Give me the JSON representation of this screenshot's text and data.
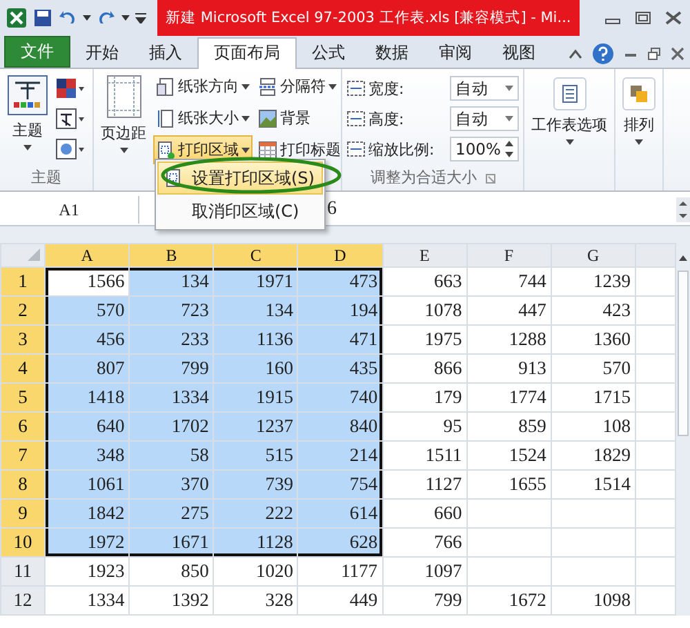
{
  "title_bar": {
    "title": "新建 Microsoft Excel 97-2003 工作表.xls  [兼容模式] - Mi..."
  },
  "tabs": [
    {
      "label": "文件",
      "kind": "file",
      "selected": false
    },
    {
      "label": "开始",
      "kind": "tab",
      "selected": false
    },
    {
      "label": "插入",
      "kind": "tab",
      "selected": false
    },
    {
      "label": "页面布局",
      "kind": "tab",
      "selected": true
    },
    {
      "label": "公式",
      "kind": "tab",
      "selected": false
    },
    {
      "label": "数据",
      "kind": "tab",
      "selected": false
    },
    {
      "label": "审阅",
      "kind": "tab",
      "selected": false
    },
    {
      "label": "视图",
      "kind": "tab",
      "selected": false
    }
  ],
  "theme_group": {
    "button": "主题",
    "label": "主题"
  },
  "page_setup_group": {
    "margins": "页边距",
    "items": [
      {
        "label": "纸张方向",
        "kind": "orientation",
        "dropdown": true,
        "active": false
      },
      {
        "label": "分隔符",
        "kind": "breaks",
        "dropdown": true,
        "active": false
      },
      {
        "label": "纸张大小",
        "kind": "size",
        "dropdown": true,
        "active": false
      },
      {
        "label": "背景",
        "kind": "background",
        "dropdown": false,
        "active": false
      },
      {
        "label": "打印区域",
        "kind": "print-area",
        "dropdown": true,
        "active": true
      },
      {
        "label": "打印标题",
        "kind": "print-titles",
        "dropdown": false,
        "active": false
      }
    ]
  },
  "scale_group": {
    "label": "调整为合适大小",
    "fields": [
      {
        "label": "宽度:",
        "value": "自动",
        "kind": "dropdown"
      },
      {
        "label": "高度:",
        "value": "自动",
        "kind": "dropdown"
      },
      {
        "label": "缩放比例:",
        "value": "100%",
        "kind": "spinner"
      }
    ]
  },
  "big_buttons": [
    {
      "label": "工作表选项",
      "kind": "sheet-options"
    },
    {
      "label": "排列",
      "kind": "arrange"
    }
  ],
  "menu": {
    "items": [
      {
        "label": "设置打印区域(S)",
        "selected": true,
        "circled": true
      },
      {
        "label": "取消印区域(C)",
        "selected": false,
        "circled": false
      }
    ]
  },
  "formula_bar": {
    "name_box": "A1",
    "value": "6"
  },
  "sheet": {
    "columns": [
      {
        "label": "A",
        "selected": true
      },
      {
        "label": "B",
        "selected": true
      },
      {
        "label": "C",
        "selected": true
      },
      {
        "label": "D",
        "selected": true
      },
      {
        "label": "E",
        "selected": false
      },
      {
        "label": "F",
        "selected": false
      },
      {
        "label": "G",
        "selected": false
      }
    ],
    "rows": [
      {
        "number": "1",
        "selected": true,
        "cells": [
          "1566",
          "134",
          "1971",
          "473",
          "663",
          "744",
          "1239"
        ]
      },
      {
        "number": "2",
        "selected": true,
        "cells": [
          "570",
          "723",
          "134",
          "194",
          "1078",
          "447",
          "423"
        ]
      },
      {
        "number": "3",
        "selected": true,
        "cells": [
          "456",
          "233",
          "1136",
          "471",
          "1975",
          "1288",
          "1360"
        ]
      },
      {
        "number": "4",
        "selected": true,
        "cells": [
          "807",
          "799",
          "160",
          "435",
          "866",
          "913",
          "570"
        ]
      },
      {
        "number": "5",
        "selected": true,
        "cells": [
          "1418",
          "1334",
          "1915",
          "740",
          "179",
          "1774",
          "1715"
        ]
      },
      {
        "number": "6",
        "selected": true,
        "cells": [
          "640",
          "1702",
          "1237",
          "840",
          "95",
          "859",
          "108"
        ]
      },
      {
        "number": "7",
        "selected": true,
        "cells": [
          "348",
          "58",
          "515",
          "214",
          "1511",
          "1524",
          "1829"
        ]
      },
      {
        "number": "8",
        "selected": true,
        "cells": [
          "1061",
          "370",
          "739",
          "754",
          "1127",
          "1655",
          "1514"
        ]
      },
      {
        "number": "9",
        "selected": true,
        "cells": [
          "1842",
          "275",
          "222",
          "614",
          "660",
          null,
          null
        ]
      },
      {
        "number": "10",
        "selected": true,
        "cells": [
          "1972",
          "1671",
          "1128",
          "628",
          "766",
          null,
          null
        ]
      },
      {
        "number": "11",
        "selected": false,
        "cells": [
          "1923",
          "850",
          "1020",
          "1177",
          "1097",
          null,
          null
        ]
      },
      {
        "number": "12",
        "selected": false,
        "cells": [
          "1334",
          "1392",
          "328",
          "449",
          "799",
          "1672",
          "1098"
        ]
      }
    ]
  }
}
